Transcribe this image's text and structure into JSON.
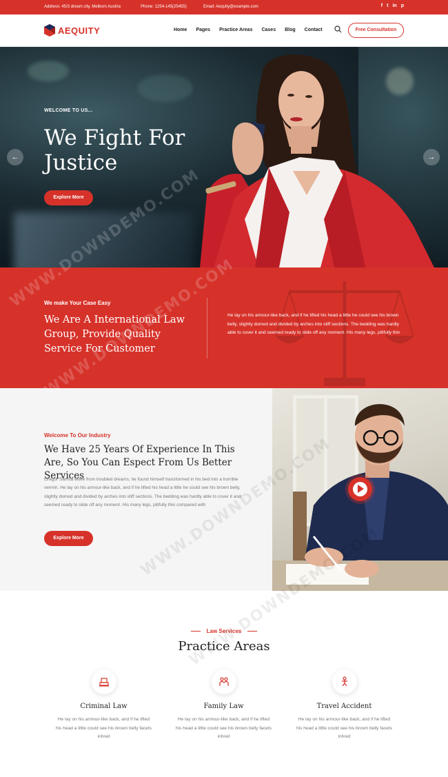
{
  "topbar": {
    "address": "Address: 45/3 dream city, Melborn Austria",
    "phone": "Phone: 1254-145(25455)",
    "email": "Email: Aequity@example.com",
    "social": [
      "f",
      "t",
      "in",
      "p"
    ]
  },
  "header": {
    "logo_text": "AEQUITY",
    "nav": [
      "Home",
      "Pages",
      "Practice Areas",
      "Cases",
      "Blog",
      "Contact"
    ],
    "cta": "Free Consultation"
  },
  "hero": {
    "kicker": "WELCOME TO US...",
    "title_line1": "We Fight For",
    "title_line2": "Justice",
    "button": "Explore More"
  },
  "band": {
    "kicker": "We make Your Case Easy",
    "title": "We Are A International Law Group, Provide Quality Service For Customer",
    "text": "He lay on his armour-like back, and if he lifted his head a little he could see his brown belly, slightly domed and divided by arches into stiff sections. The bedding was hardly able to cover it and seemed ready to slide off any moment. His many legs, pitifully thin"
  },
  "experience": {
    "kicker": "Welcome To Our Industry",
    "title": "We Have 25 Years Of Experience In This Are, So You Can Espect From Us Better Services",
    "text": "Gregor Samsa woke from troubled dreams, he found himself transformed in his bed into a horrible vermin. He lay on his armour-like back, and if he lifted his head a little he could see his brown belly, slightly domed and divided by arches into stiff sections. The bedding was hardly able to cover it and seemed ready to slide off any moment. His many legs, pitifully thin compared with",
    "button": "Explore More"
  },
  "practice": {
    "kicker": "Law Services",
    "title": "Practice Areas",
    "cards": [
      {
        "icon": "criminal-law-icon",
        "title": "Criminal Law",
        "text": "He lay on his armour-like back, and if he lifted his head a little could see his brown belly facets inhreit"
      },
      {
        "icon": "family-law-icon",
        "title": "Family Law",
        "text": "He lay on his armour-like back, and if he lifted his head a little could see his brown belly facets inhreit"
      },
      {
        "icon": "travel-accident-icon",
        "title": "Travel Accident",
        "text": "He lay on his armour-like back, and if he lifted his head a little could see his brown belly facets inhreit"
      }
    ]
  },
  "watermark": "WWW.DOWNDEMO.COM",
  "colors": {
    "accent": "#d6322a",
    "text": "#222222",
    "muted": "#777777",
    "light_bg": "#f5f5f5"
  }
}
